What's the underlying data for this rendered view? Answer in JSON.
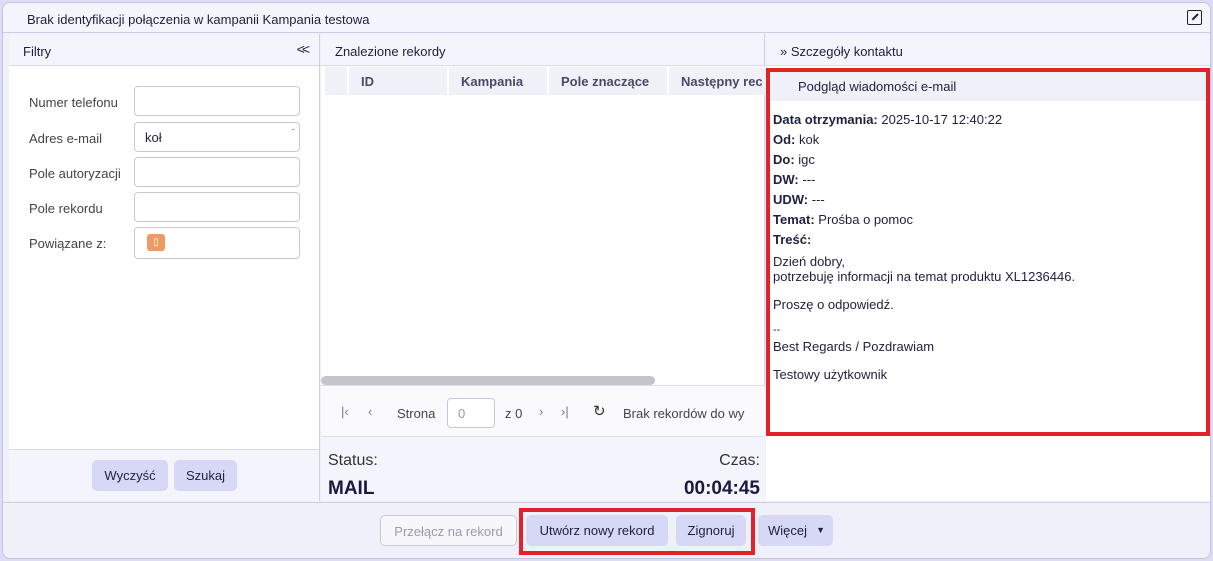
{
  "window": {
    "title": "Brak identyfikacji połączenia w kampanii Kampania testowa",
    "popout_icon": "popout-icon"
  },
  "filters": {
    "title": "Filtry",
    "collapse_label": "<<",
    "fields": [
      {
        "label": "Numer telefonu",
        "value": ""
      },
      {
        "label": "Adres e-mail",
        "value": "koł"
      },
      {
        "label": "Pole autoryzacji",
        "value": ""
      },
      {
        "label": "Pole rekordu",
        "value": ""
      },
      {
        "label": "Powiązane z:",
        "value": ""
      }
    ],
    "clear_label": "Wyczyść",
    "search_label": "Szukaj"
  },
  "records": {
    "title": "Znalezione rekordy",
    "columns": [
      "ID",
      "Kampania",
      "Pole znaczące",
      "Następny rec"
    ],
    "pager": {
      "page_label": "Strona",
      "page_placeholder": "0",
      "of_label": "z 0",
      "empty_text": "Brak rekordów do wy"
    }
  },
  "status": {
    "status_label": "Status:",
    "status_value": "MAIL",
    "time_label": "Czas:",
    "time_value": "00:04:45"
  },
  "contact": {
    "title": "» Szczegóły kontaktu",
    "preview_title": "Podgląd wiadomości e-mail",
    "received_label": "Data otrzymania:",
    "received_value": "2025-10-17 12:40:22",
    "from_label": "Od:",
    "from_value": "kok",
    "to_label": "Do:",
    "to_value": "igc",
    "cc_label": "DW:",
    "cc_value": "---",
    "bcc_label": "UDW:",
    "bcc_value": "---",
    "subject_label": "Temat:",
    "subject_value": "Prośba o pomoc",
    "body_label": "Treść:",
    "body_lines": [
      "Dzień dobry,",
      "potrzebuję informacji na temat produktu XL1236446.",
      "Proszę o odpowiedź.",
      "--",
      "Best Regards / Pozdrawiam",
      "Testowy użytkownik"
    ]
  },
  "actions": {
    "switch_label": "Przełącz na rekord",
    "create_label": "Utwórz nowy rekord",
    "ignore_label": "Zignoruj",
    "more_label": "Więcej"
  },
  "colors": {
    "accent": "#d7d7f6",
    "highlight": "#e0222a",
    "badge": "#f09a63"
  }
}
